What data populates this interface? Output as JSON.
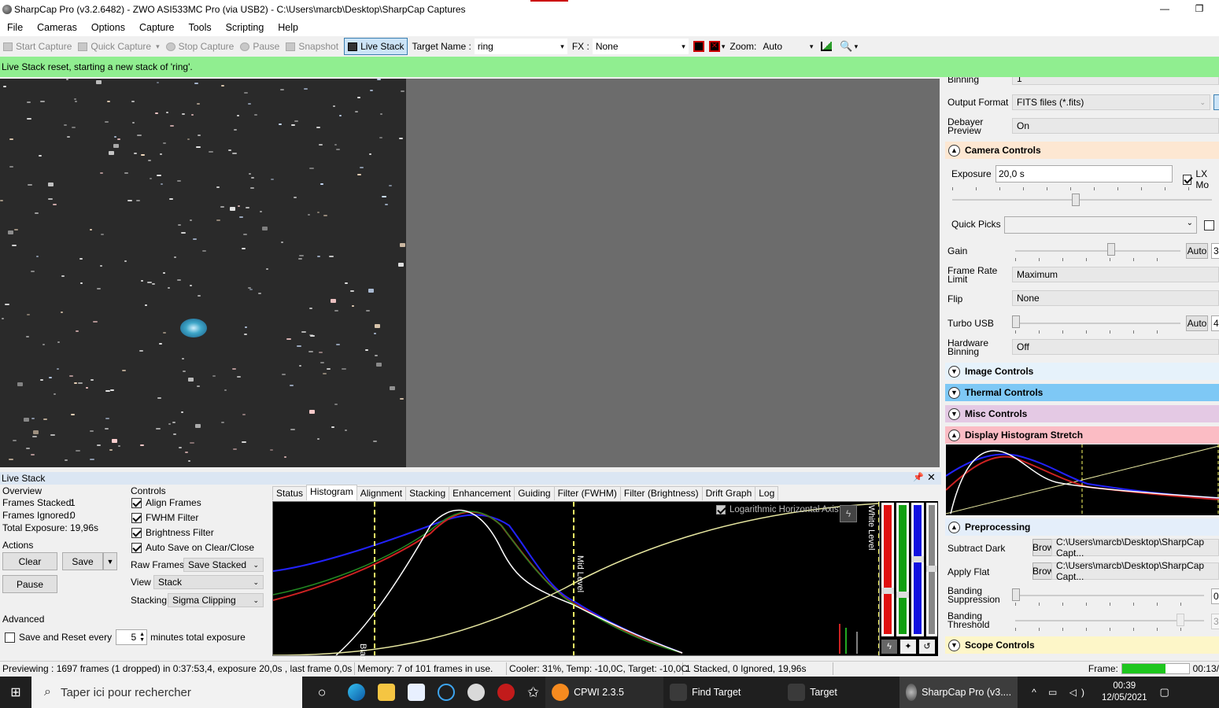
{
  "window": {
    "title": "SharpCap Pro (v3.2.6482) - ZWO ASI533MC Pro (via USB2) - C:\\Users\\marcb\\Desktop\\SharpCap Captures",
    "min": "—",
    "max": "❐"
  },
  "menu": [
    "File",
    "Cameras",
    "Options",
    "Capture",
    "Tools",
    "Scripting",
    "Help"
  ],
  "toolbar": {
    "start_capture": "Start Capture",
    "quick_capture": "Quick Capture",
    "stop_capture": "Stop Capture",
    "pause": "Pause",
    "snapshot": "Snapshot",
    "live_stack": "Live Stack",
    "target_label": "Target Name :",
    "target_value": "ring",
    "fx_label": "FX :",
    "fx_value": "None",
    "zoom_label": "Zoom:",
    "zoom_value": "Auto"
  },
  "notice": "Live Stack reset, starting a new stack of 'ring'.",
  "livestack": {
    "header": "Live Stack",
    "overview": {
      "title": "Overview",
      "frames_stacked_label": "Frames Stacked:",
      "frames_stacked": "1",
      "frames_ignored_label": "Frames Ignored:",
      "frames_ignored": "0",
      "total_exposure_label": "Total Exposure:",
      "total_exposure": "19,96s"
    },
    "actions": {
      "title": "Actions",
      "clear": "Clear",
      "save": "Save",
      "pause": "Pause"
    },
    "advanced": {
      "title": "Advanced",
      "save_reset": "Save and Reset every",
      "value": "5",
      "suffix": "minutes total exposure"
    },
    "controls": {
      "title": "Controls",
      "align": "Align Frames",
      "fwhm": "FWHM Filter",
      "brightness": "Brightness Filter",
      "autosave": "Auto Save on Clear/Close",
      "raw_label": "Raw Frames",
      "raw_value": "Save Stacked",
      "view_label": "View",
      "view_value": "Stack",
      "stacking_label": "Stacking",
      "stacking_value": "Sigma Clipping"
    },
    "tabs": [
      "Status",
      "Histogram",
      "Alignment",
      "Stacking",
      "Enhancement",
      "Guiding",
      "Filter (FWHM)",
      "Filter (Brightness)",
      "Drift Graph",
      "Log"
    ],
    "active_tab": "Histogram",
    "histogram": {
      "log_axis": "Logarithmic Horizontal Axis",
      "black_level": "Black Level",
      "mid_level": "Mid Level",
      "white_level": "White Level"
    }
  },
  "status": {
    "previewing": "Previewing : 1697 frames (1 dropped) in 0:37:53,4, exposure 20,0s , last frame 0,0s",
    "memory": "Memory: 7 of 101 frames in use.",
    "cooler": "Cooler: 31%, Temp: -10,0C, Target: -10,0C",
    "stacked": "1 Stacked, 0 Ignored, 19,96s",
    "frame_label": "Frame:",
    "time": "00:13/"
  },
  "right": {
    "binning_label": "Binning",
    "binning_value": "1",
    "output_format_label": "Output Format",
    "output_format_value": "FITS files (*.fits)",
    "debayer_label": "Debayer Preview",
    "debayer_value": "On",
    "camera_controls": "Camera Controls",
    "exposure_label": "Exposure",
    "exposure_value": "20,0 s",
    "lx_label": "LX Mo",
    "quick_picks_label": "Quick Picks",
    "gain_label": "Gain",
    "auto": "Auto",
    "gain_value": "3",
    "frame_rate_label": "Frame Rate Limit",
    "frame_rate_value": "Maximum",
    "flip_label": "Flip",
    "flip_value": "None",
    "turbo_label": "Turbo USB",
    "turbo_value": "4",
    "hw_binning_label": "Hardware Binning",
    "hw_binning_value": "Off",
    "image_controls": "Image Controls",
    "thermal_controls": "Thermal Controls",
    "misc_controls": "Misc Controls",
    "display_histogram": "Display Histogram Stretch",
    "preprocessing": "Preprocessing",
    "subtract_dark_label": "Subtract Dark",
    "browse": "Browse...",
    "dark_path": "C:\\Users\\marcb\\Desktop\\SharpCap Capt...",
    "apply_flat_label": "Apply Flat",
    "flat_path": "C:\\Users\\marcb\\Desktop\\SharpCap Capt...",
    "banding_supp_label": "Banding Suppression",
    "banding_supp_value": "0",
    "banding_thr_label": "Banding Threshold",
    "banding_thr_value": "3",
    "scope_controls": "Scope Controls"
  },
  "taskbar": {
    "search": "Taper ici pour rechercher",
    "cpwi": "CPWI 2.3.5",
    "find_target": "Find Target",
    "target": "Target",
    "sharpcap": "SharpCap Pro (v3....",
    "time": "00:39",
    "date": "12/05/2021"
  },
  "colors": {
    "notice_bg": "#90ee90",
    "camera_section": "#fde7d2",
    "image_section": "#e6f2fb",
    "thermal_section": "#7ec8f5",
    "misc_section": "#e4c9e4",
    "display_section": "#fbbcc4",
    "preprocessing_section": "#e4eefa",
    "scope_section": "#fdf6c8"
  }
}
